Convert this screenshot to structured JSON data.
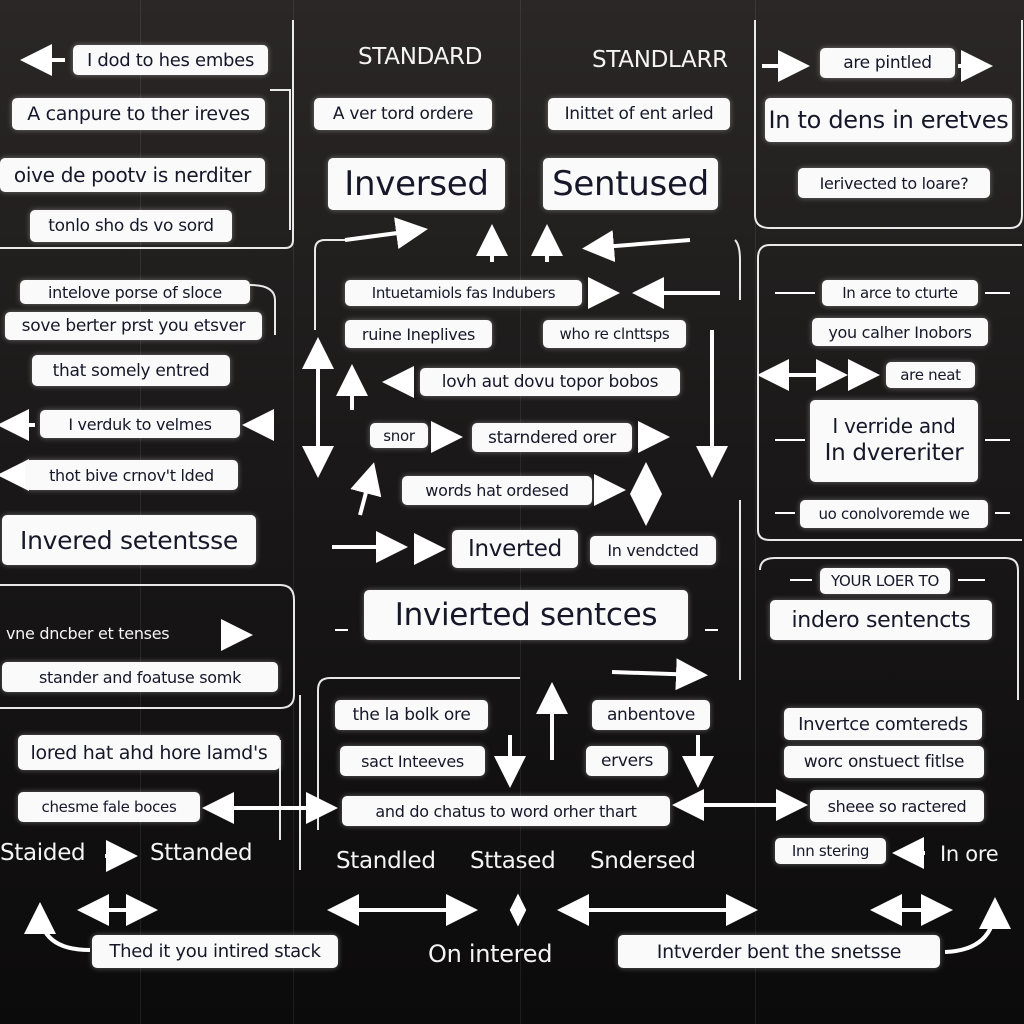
{
  "labels": {
    "l1": "I dod to hes embes",
    "l2": "A canpure to ther ireves",
    "l3": "oive de pootv is nerditer",
    "l4": "tonlo sho ds vo sord",
    "h1": "STANDARD",
    "h2": "STANDLARR",
    "c1": "A ver tord ordere",
    "c2": "Inittet of ent arled",
    "c3": "Inversed",
    "c4": "Sentused",
    "r1": "are pintled",
    "r2": "In to dens in eretves",
    "r3": "Ierivected to loare?",
    "l5": "intelove porse of sloce",
    "l6": "sove berter prst you etsver",
    "l7": "that somely entred",
    "l8": "I verduk to velmes",
    "l9": "thot bive crnov't lded",
    "l10": "Invered setentsse",
    "m1": "Intuetamiols fas Indubers",
    "m2": "ruine Ineplives",
    "m3": "who re clnttsps",
    "m4": "lovh aut dovu topor bobos",
    "m5": "snor",
    "m6": "starndered orer",
    "m7": "words hat ordesed",
    "m8": "Inverted",
    "m9": "In vendcted",
    "m10": "Invierted sentces",
    "r4": "In arce to cturte",
    "r5": "you calher Inobors",
    "r6": "are neat",
    "r7a": "I verride and",
    "r7b": "In dvereriter",
    "r8": "uo conolvoremde we",
    "r9": "YOUR LOER TO",
    "r10": "indero sentencts",
    "l11": "vne dncber et tenses",
    "l12": "stander and foatuse somk",
    "l13": "lored hat ahd hore lamd's",
    "l14": "chesme fale boces",
    "m11": "the la bolk ore",
    "m12": "sact Inteeves",
    "m13": "anbentove",
    "m14": "ervers",
    "m15": "and do chatus to word orher thart",
    "r11": "Invertce comtereds",
    "r12": "worc onstuect fitlse",
    "r13": "sheee so ractered",
    "r14": "Inn stering",
    "r15": "In ore",
    "s1": "Staided",
    "s2": "Sttanded",
    "s3": "Standled",
    "s4": "Sttased",
    "s5": "Sndersed",
    "f1": "Thed it you intired stack",
    "f2": "On intered",
    "f3": "Intverder bent the snetsse"
  },
  "colors": {
    "background": "#1a1818",
    "box": "#fafafa",
    "text": "#17172a",
    "line": "#ffffff"
  },
  "icons": [
    "arrow-right-icon",
    "arrow-left-icon",
    "arrow-up-icon",
    "arrow-down-icon",
    "double-arrow-icon"
  ]
}
